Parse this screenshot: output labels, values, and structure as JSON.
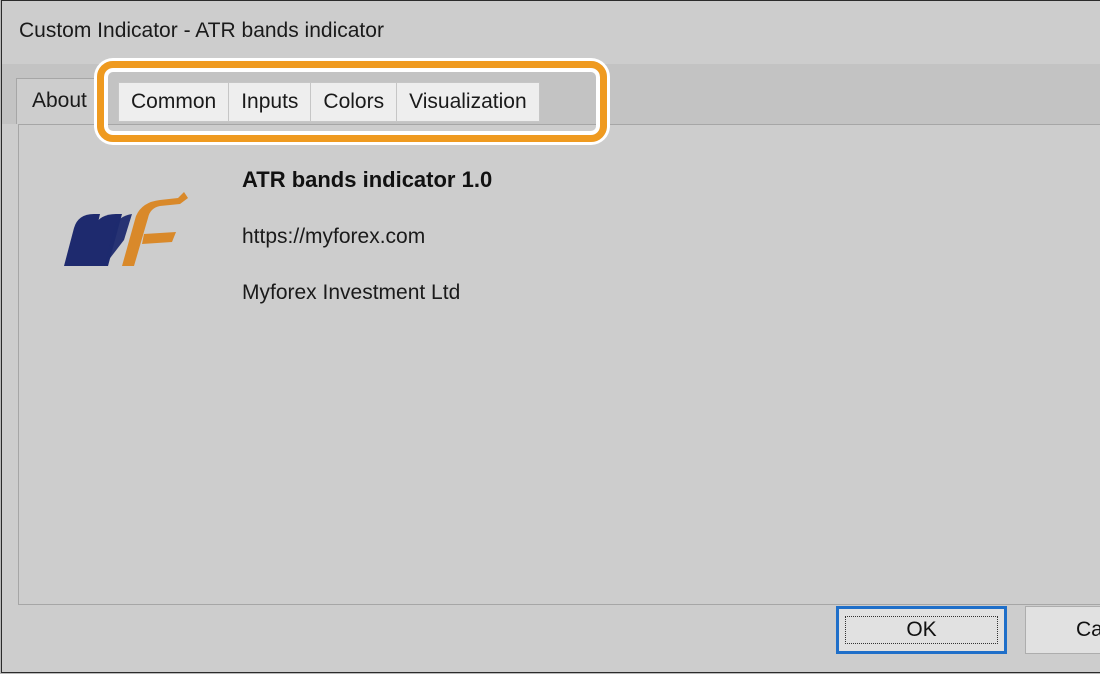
{
  "window": {
    "title": "Custom Indicator - ATR bands indicator"
  },
  "tabs": {
    "active": "About",
    "items": [
      {
        "label": "Common"
      },
      {
        "label": "Inputs"
      },
      {
        "label": "Colors"
      },
      {
        "label": "Visualization"
      }
    ]
  },
  "about": {
    "name": "ATR bands indicator 1.0",
    "link": "https://myforex.com",
    "company": "Myforex Investment Ltd"
  },
  "buttons": {
    "ok": "OK",
    "cancel": "Ca"
  },
  "highlight_color": "#ef9a1f",
  "logo_colors": {
    "navy": "#1e2a6e",
    "orange": "#d9892a"
  }
}
